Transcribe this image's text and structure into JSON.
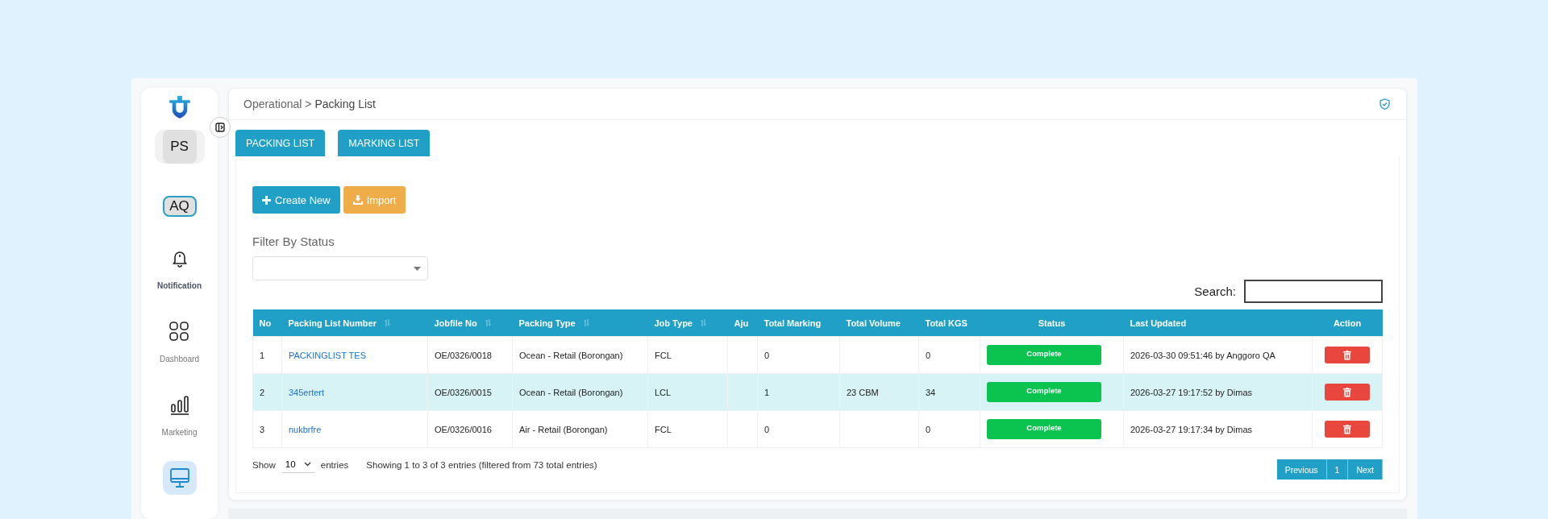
{
  "sidebar": {
    "avatars": [
      {
        "initials": "PS",
        "kind": "plain"
      },
      {
        "initials": "AQ",
        "kind": "outlined"
      }
    ],
    "items": [
      {
        "label": "Notification",
        "bold": true,
        "selected": false
      },
      {
        "label": "Dashboard",
        "bold": false,
        "selected": false
      },
      {
        "label": "Marketing",
        "bold": false,
        "selected": false
      },
      {
        "selected": true
      }
    ]
  },
  "breadcrumb": {
    "parent": "Operational >",
    "current": "Packing List"
  },
  "tabs": [
    {
      "label": "PACKING LIST"
    },
    {
      "label": "MARKING LIST"
    }
  ],
  "buttons": [
    {
      "label": "Create New",
      "kind": "create"
    },
    {
      "label": "Import",
      "kind": "import"
    }
  ],
  "filter": {
    "label": "Filter By Status"
  },
  "search": {
    "label": "Search:"
  },
  "table": {
    "columns": [
      {
        "label": "No",
        "sortable": false
      },
      {
        "label": "Packing List Number",
        "sortable": true
      },
      {
        "label": "Jobfile No",
        "sortable": true
      },
      {
        "label": "Packing Type",
        "sortable": true
      },
      {
        "label": "Job Type",
        "sortable": true
      },
      {
        "label": "Aju",
        "sortable": false
      },
      {
        "label": "Total Marking",
        "sortable": false
      },
      {
        "label": "Total Volume",
        "sortable": false
      },
      {
        "label": "Total KGS",
        "sortable": false
      },
      {
        "label": "Status",
        "sortable": false
      },
      {
        "label": "Last Updated",
        "sortable": false
      },
      {
        "label": "Action",
        "sortable": false
      }
    ],
    "rows": [
      {
        "selected": false,
        "cells": [
          "1",
          "PACKINGLIST TES",
          "OE/0326/0018",
          "Ocean - Retail (Borongan)",
          "FCL",
          "",
          "0",
          "",
          "0",
          "Complete",
          "2026-03-30 09:51:46 by Anggoro QA"
        ]
      },
      {
        "selected": true,
        "cells": [
          "2",
          "345ertert",
          "OE/0326/0015",
          "Ocean - Retail (Borongan)",
          "LCL",
          "",
          "1",
          "23 CBM",
          "34",
          "Complete",
          "2026-03-27 19:17:52 by Dimas"
        ]
      },
      {
        "selected": false,
        "cells": [
          "3",
          "nukbrfre",
          "OE/0326/0016",
          "Air - Retail (Borongan)",
          "FCL",
          "",
          "0",
          "",
          "0",
          "Complete",
          "2026-03-27 19:17:34 by Dimas"
        ]
      }
    ]
  },
  "length": {
    "before": "Show",
    "value": "10",
    "after": "entries"
  },
  "info": "Showing 1 to 3 of 3 entries (filtered from 73 total entries)",
  "pagination": [
    "Previous",
    "1",
    "Next"
  ]
}
